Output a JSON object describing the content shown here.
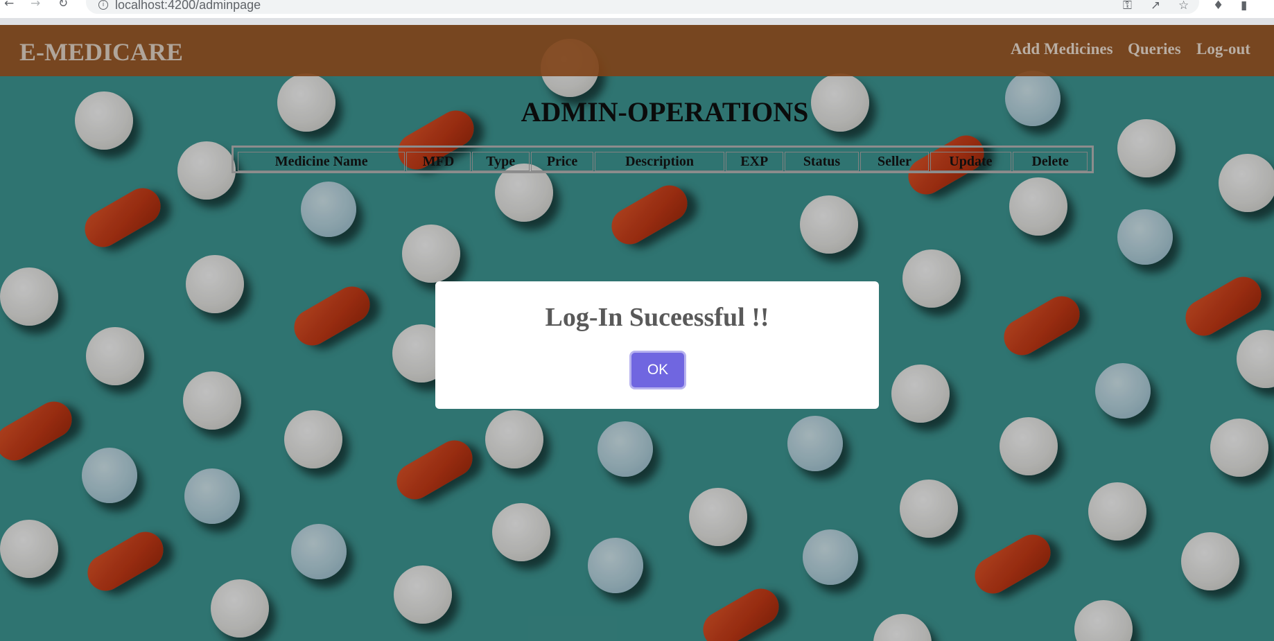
{
  "browser": {
    "url": "localhost:4200/adminpage"
  },
  "header": {
    "brand": "E-MEDICARE",
    "nav": [
      "Add Medicines",
      "Queries",
      "Log-out"
    ]
  },
  "page_title": "ADMIN-OPERATIONS",
  "table": {
    "columns": [
      "Medicine Name",
      "MFD",
      "Type",
      "Price",
      "Description",
      "EXP",
      "Status",
      "Seller",
      "Update",
      "Delete"
    ]
  },
  "dialog": {
    "title": "Log-In Suceessful !!",
    "ok_label": "OK"
  }
}
